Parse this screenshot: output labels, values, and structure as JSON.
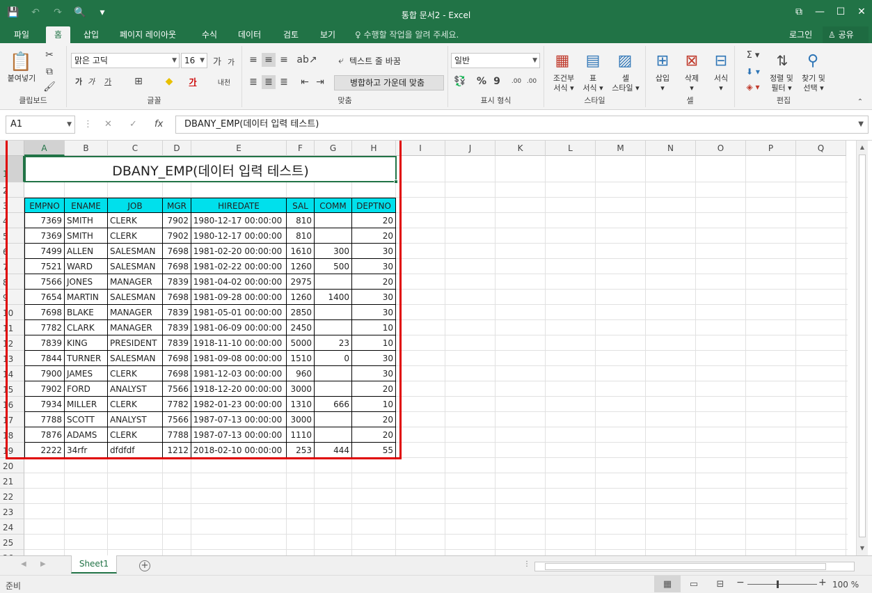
{
  "window": {
    "title": "통합 문서2 - Excel",
    "buttons": [
      "⧉",
      "—",
      "☐",
      "✕"
    ]
  },
  "qat": {
    "save_icon": "💾",
    "undo_icon": "↶",
    "redo_icon": "↷",
    "preview_icon": "🔍",
    "more_icon": "▾"
  },
  "tabs": [
    {
      "label": "파일"
    },
    {
      "label": "홈"
    },
    {
      "label": "삽입"
    },
    {
      "label": "페이지 레이아웃"
    },
    {
      "label": "수식"
    },
    {
      "label": "데이터"
    },
    {
      "label": "검토"
    },
    {
      "label": "보기"
    }
  ],
  "tell_me": "♀ 수행할 작업을 알려 주세요.",
  "login": "로그인",
  "share": "♙ 공유",
  "ribbon": {
    "clipboard": {
      "paste": "붙여넣기",
      "group": "클립보드"
    },
    "font": {
      "name": "맑은 고딕",
      "size": "16",
      "bold": "가",
      "italic": "가",
      "underline": "가",
      "color": "가",
      "group": "글꼴",
      "grow": "가",
      "shrink": "가",
      "phonetic": "내천"
    },
    "alignment": {
      "wrap": "텍스트 줄 바꿈",
      "merge": "병합하고 가운데 맞춤",
      "group": "맞춤"
    },
    "number": {
      "format": "일반",
      "percent": "%",
      "comma": "9",
      "dec_inc": ".00",
      "dec_dec": ".00",
      "group": "표시 형식"
    },
    "styles": {
      "cond": "조건부\n서식 ▾",
      "table": "표\n서식 ▾",
      "cell": "셀\n스타일 ▾",
      "group": "스타일"
    },
    "cells": {
      "insert": "삽입\n▾",
      "delete": "삭제\n▾",
      "format": "서식\n▾",
      "group": "셀"
    },
    "editing": {
      "sum": "Σ ▾",
      "fill": "⬇ ▾",
      "clear": "◈ ▾",
      "sort": "정렬 및\n필터 ▾",
      "find": "찾기 및\n선택 ▾",
      "group": "편집"
    }
  },
  "formula_bar": {
    "namebox": "A1",
    "content": "DBANY_EMP(데이터 입력 테스트)"
  },
  "columns": [
    "A",
    "B",
    "C",
    "D",
    "E",
    "F",
    "G",
    "H",
    "I",
    "J",
    "K",
    "L",
    "M",
    "N",
    "O",
    "P",
    "Q"
  ],
  "rows": [
    "1",
    "2",
    "3",
    "4",
    "5",
    "6",
    "7",
    "8",
    "9",
    "10",
    "11",
    "12",
    "13",
    "14",
    "15",
    "16",
    "17",
    "18",
    "19",
    "20",
    "21",
    "22",
    "23",
    "24",
    "25",
    "26"
  ],
  "sheet": {
    "title": "DBANY_EMP(데이터 입력 테스트)",
    "headers": [
      "EMPNO",
      "ENAME",
      "JOB",
      "MGR",
      "HIREDATE",
      "SAL",
      "COMM",
      "DEPTNO"
    ],
    "data": [
      [
        "7369",
        "SMITH",
        "CLERK",
        "7902",
        "1980-12-17 00:00:00",
        "810",
        "",
        "20"
      ],
      [
        "7369",
        "SMITH",
        "CLERK",
        "7902",
        "1980-12-17 00:00:00",
        "810",
        "",
        "20"
      ],
      [
        "7499",
        "ALLEN",
        "SALESMAN",
        "7698",
        "1981-02-20 00:00:00",
        "1610",
        "300",
        "30"
      ],
      [
        "7521",
        "WARD",
        "SALESMAN",
        "7698",
        "1981-02-22 00:00:00",
        "1260",
        "500",
        "30"
      ],
      [
        "7566",
        "JONES",
        "MANAGER",
        "7839",
        "1981-04-02 00:00:00",
        "2975",
        "",
        "20"
      ],
      [
        "7654",
        "MARTIN",
        "SALESMAN",
        "7698",
        "1981-09-28 00:00:00",
        "1260",
        "1400",
        "30"
      ],
      [
        "7698",
        "BLAKE",
        "MANAGER",
        "7839",
        "1981-05-01 00:00:00",
        "2850",
        "",
        "30"
      ],
      [
        "7782",
        "CLARK",
        "MANAGER",
        "7839",
        "1981-06-09 00:00:00",
        "2450",
        "",
        "10"
      ],
      [
        "7839",
        "KING",
        "PRESIDENT",
        "7839",
        "1918-11-10 00:00:00",
        "5000",
        "23",
        "10"
      ],
      [
        "7844",
        "TURNER",
        "SALESMAN",
        "7698",
        "1981-09-08 00:00:00",
        "1510",
        "0",
        "30"
      ],
      [
        "7900",
        "JAMES",
        "CLERK",
        "7698",
        "1981-12-03 00:00:00",
        "960",
        "",
        "30"
      ],
      [
        "7902",
        "FORD",
        "ANALYST",
        "7566",
        "1918-12-20 00:00:00",
        "3000",
        "",
        "20"
      ],
      [
        "7934",
        "MILLER",
        "CLERK",
        "7782",
        "1982-01-23 00:00:00",
        "1310",
        "666",
        "10"
      ],
      [
        "7788",
        "SCOTT",
        "ANALYST",
        "7566",
        "1987-07-13 00:00:00",
        "3000",
        "",
        "20"
      ],
      [
        "7876",
        "ADAMS",
        "CLERK",
        "7788",
        "1987-07-13 00:00:00",
        "1110",
        "",
        "20"
      ],
      [
        "2222",
        "34rfr",
        "dfdfdf",
        "1212",
        "2018-02-10 00:00:00",
        "253",
        "444",
        "55"
      ]
    ]
  },
  "sheet_tabs": {
    "active": "Sheet1",
    "add": "+"
  },
  "status": {
    "ready": "준비",
    "zoom": "100 %"
  },
  "colors": {
    "accent": "#217346",
    "header_fill": "#00e0ec",
    "highlight": "#e00000"
  }
}
